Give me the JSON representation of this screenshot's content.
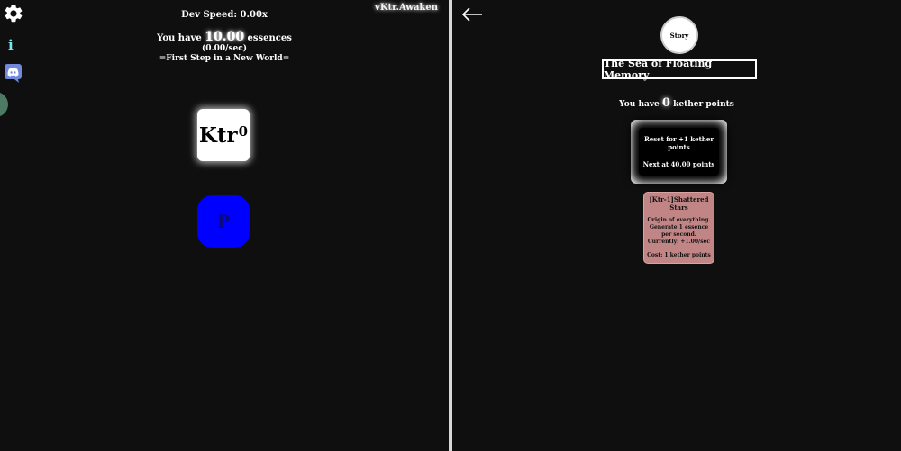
{
  "header": {
    "version": "vKtr.Awaken",
    "dev_speed": "Dev Speed: 0.00x",
    "essence_prefix": "You have",
    "essence_amount": "10.00",
    "essence_suffix": "essences",
    "essence_rate": "(0.00/sec)",
    "chapter": "=First Step in a New World="
  },
  "sidebar": {
    "settings_icon": "gear-icon",
    "info_icon_label": "i",
    "discord_icon": "discord-icon"
  },
  "tree": {
    "ktr_label": "Ktr",
    "ktr_exponent": "0",
    "p_label": "P"
  },
  "layer_panel": {
    "story_label": "Story",
    "title": "The Sea of Floating Memory",
    "kether_prefix": "You have",
    "kether_amount": "0",
    "kether_suffix": "kether points",
    "reset_label": "Reset for +1 kether points",
    "next_label": "Next at 40.00 points"
  },
  "upgrade": {
    "title": "[Ktr-1]Shattered Stars",
    "description": "Origin of everything. Generate 1 essence per second.",
    "current": "Currently: +1.00/sec",
    "cost": "Cost: 1 kether points"
  },
  "colors": {
    "background": "#0f0f0f",
    "divider": "#d8d8d8",
    "p_node": "#0000ff",
    "upgrade_card": "#c28586",
    "info_icon": "#78e8ee",
    "side_tab": "#4c7a62"
  }
}
